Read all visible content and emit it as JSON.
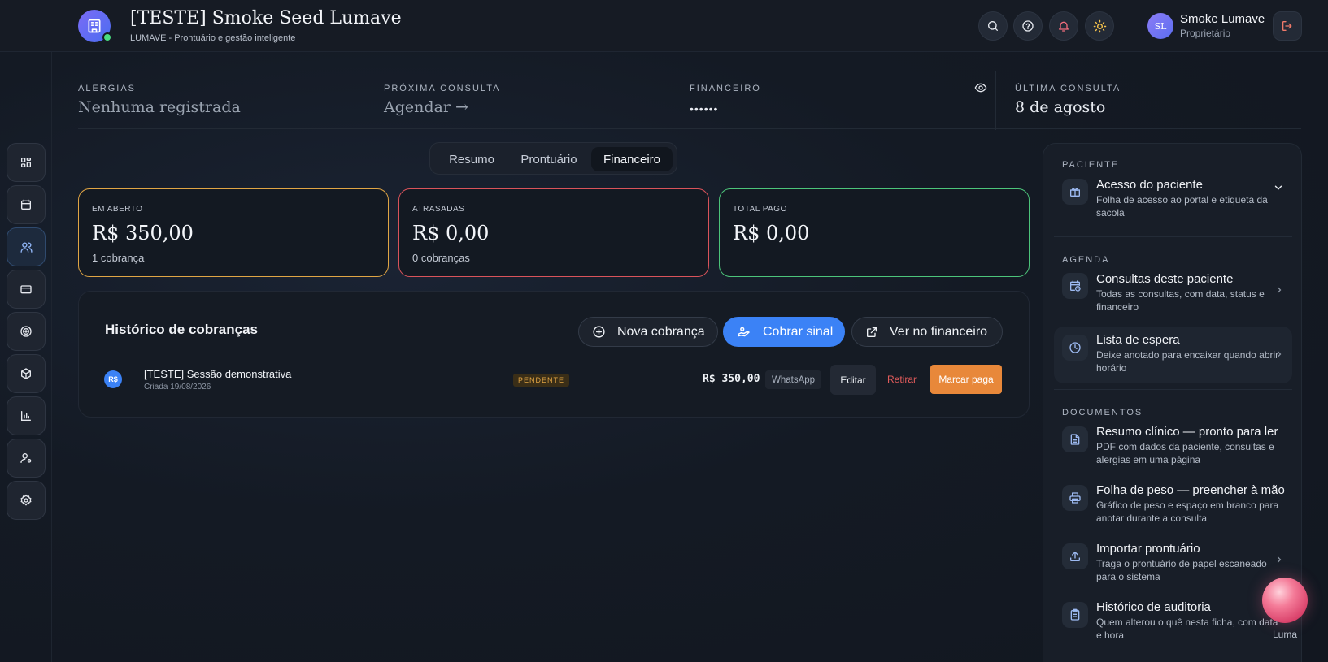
{
  "header": {
    "title": "[TESTE] Smoke Seed Lumave",
    "subtitle": "LUMAVE - Prontuário e gestão inteligente",
    "user": {
      "initials": "SL",
      "name": "Smoke Lumave",
      "role": "Proprietário"
    }
  },
  "sidebar": {
    "items": [
      {
        "name": "dashboard",
        "icon": "grid-icon"
      },
      {
        "name": "agenda",
        "icon": "calendar-icon"
      },
      {
        "name": "pacientes",
        "icon": "users-icon",
        "active": true
      },
      {
        "name": "financeiro",
        "icon": "credit-card-icon"
      },
      {
        "name": "metas",
        "icon": "target-icon"
      },
      {
        "name": "estoque",
        "icon": "box-icon"
      },
      {
        "name": "relatorios",
        "icon": "bar-chart-icon"
      },
      {
        "name": "equipe",
        "icon": "user-cog-icon"
      },
      {
        "name": "configuracoes",
        "icon": "settings-icon"
      }
    ]
  },
  "stats": {
    "alergias": {
      "label": "ALERGIAS",
      "value": "Nenhuma registrada"
    },
    "proxima": {
      "label": "PRÓXIMA CONSULTA",
      "value": "Agendar →"
    },
    "financeiro": {
      "label": "FINANCEIRO",
      "value": "••••••"
    },
    "ultima": {
      "label": "ÚLTIMA CONSULTA",
      "value": "8 de agosto"
    }
  },
  "tabs": [
    {
      "label": "Resumo",
      "active": false
    },
    {
      "label": "Prontuário",
      "active": false
    },
    {
      "label": "Financeiro",
      "active": true
    }
  ],
  "cards": {
    "aberto": {
      "label": "EM ABERTO",
      "value": "R$ 350,00",
      "sub": "1 cobrança",
      "color": "#e0a544"
    },
    "atrasadas": {
      "label": "ATRASADAS",
      "value": "R$ 0,00",
      "sub": "0 cobranças",
      "color": "#d9535a"
    },
    "pago": {
      "label": "TOTAL PAGO",
      "value": "R$ 0,00",
      "sub": "",
      "color": "#4cc47a"
    }
  },
  "history": {
    "title": "Histórico de cobranças",
    "buttons": {
      "nova": "Nova cobrança",
      "sinal": "Cobrar sinal",
      "ver": "Ver no financeiro"
    },
    "rows": [
      {
        "avatar": "R$",
        "title": "[TESTE] Sessão demonstrativa",
        "created": "Criada 19/08/2026",
        "status": "PENDENTE",
        "amount": "R$ 350,00",
        "channel": "WhatsApp",
        "edit": "Editar",
        "remove": "Retirar",
        "mark_paid": "Marcar paga"
      }
    ]
  },
  "right_panel": {
    "paciente": {
      "section": "PACIENTE",
      "items": [
        {
          "title": "Acesso do paciente",
          "desc": "Folha de acesso ao portal e etiqueta da sacola",
          "icon": "gift-icon"
        }
      ]
    },
    "agenda": {
      "section": "AGENDA",
      "items": [
        {
          "title": "Consultas deste paciente",
          "desc": "Todas as consultas, com data, status e financeiro",
          "icon": "calendar-clock-icon"
        },
        {
          "title": "Lista de espera",
          "desc": "Deixe anotado para encaixar quando abrir horário",
          "icon": "clock-icon"
        }
      ]
    },
    "documentos": {
      "section": "DOCUMENTOS",
      "items": [
        {
          "title": "Resumo clínico — pronto para ler",
          "desc": "PDF com dados da paciente, consultas e alergias em uma página",
          "icon": "file-text-icon"
        },
        {
          "title": "Folha de peso — preencher à mão",
          "desc": "Gráfico de peso e espaço em branco para anotar durante a consulta",
          "icon": "printer-icon"
        },
        {
          "title": "Importar prontuário",
          "desc": "Traga o prontuário de papel escaneado para o sistema",
          "icon": "upload-icon"
        },
        {
          "title": "Histórico de auditoria",
          "desc": "Quem alterou o quê nesta ficha, com data e hora",
          "icon": "clipboard-icon"
        }
      ]
    }
  },
  "luma": {
    "label": "Luma"
  }
}
